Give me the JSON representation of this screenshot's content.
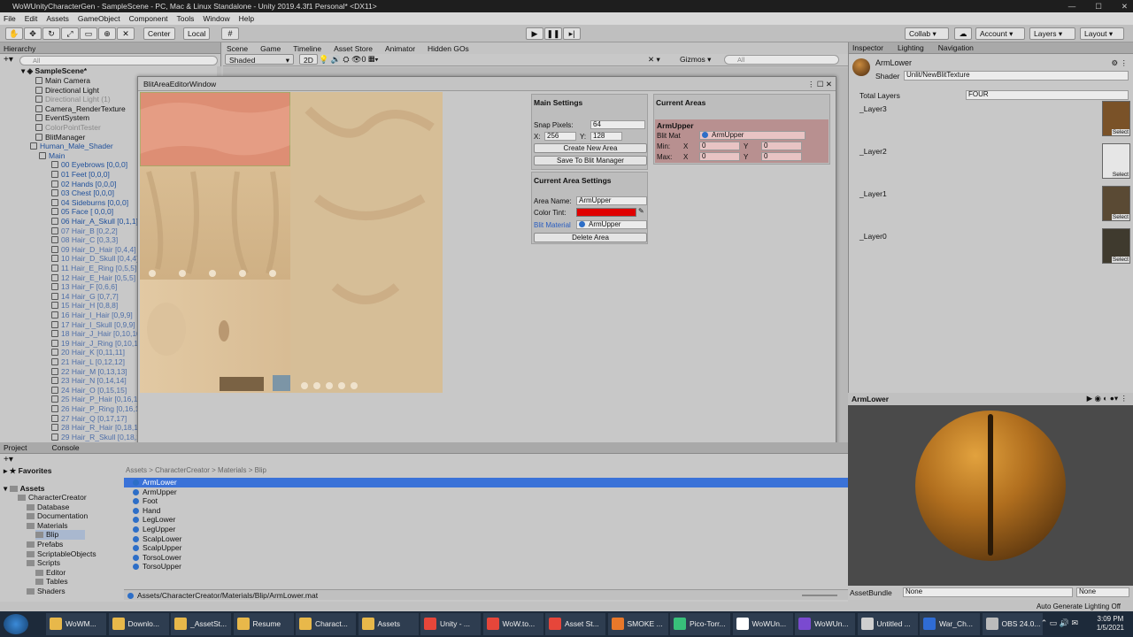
{
  "window": {
    "title": "WoWUnityCharacterGen - SampleScene - PC, Mac & Linux Standalone - Unity 2019.4.3f1 Personal* <DX11>"
  },
  "menu": [
    "File",
    "Edit",
    "Assets",
    "GameObject",
    "Component",
    "Tools",
    "Window",
    "Help"
  ],
  "toolbar": {
    "center": "Center",
    "local": "Local",
    "collab": "Collab",
    "account": "Account",
    "layers": "Layers",
    "layout": "Layout"
  },
  "hierarchy": {
    "tab": "Hierarchy",
    "search": "All",
    "scene": "SampleScene*",
    "items": [
      {
        "label": "Main Camera",
        "style": ""
      },
      {
        "label": "Directional Light",
        "style": ""
      },
      {
        "label": "Directional Light (1)",
        "style": "dim"
      },
      {
        "label": "Camera_RenderTexture",
        "style": ""
      },
      {
        "label": "EventSystem",
        "style": ""
      },
      {
        "label": "ColorPointTester",
        "style": "dim"
      },
      {
        "label": "BlitManager",
        "style": ""
      },
      {
        "label": "Human_Male_Shader",
        "style": "blue"
      },
      {
        "label": "Main",
        "style": "blue"
      },
      {
        "label": "00 Eyebrows [0,0,0]",
        "style": "blue"
      },
      {
        "label": "01 Feet [0,0,0]",
        "style": "blue"
      },
      {
        "label": "02 Hands [0,0,0]",
        "style": "blue"
      },
      {
        "label": "03 Chest [0,0,0]",
        "style": "blue"
      },
      {
        "label": "04 Sideburns [0,0,0]",
        "style": "blue"
      },
      {
        "label": "05 Face [ 0,0,0]",
        "style": "blue"
      },
      {
        "label": "06 Hair_A_Skull [0,1,1]",
        "style": "blue"
      },
      {
        "label": "07 Hair_B [0,2,2]",
        "style": "paleblue"
      },
      {
        "label": "08 Hair_C [0,3,3]",
        "style": "paleblue"
      },
      {
        "label": "09 Hair_D_Hair [0,4,4]",
        "style": "paleblue"
      },
      {
        "label": "10 Hair_D_Skull [0,4,4]",
        "style": "paleblue"
      },
      {
        "label": "11 Hair_E_Ring [0,5,5]",
        "style": "paleblue"
      },
      {
        "label": "12 Hair_E_Hair [0,5,5]",
        "style": "paleblue"
      },
      {
        "label": "13 Hair_F [0,6,6]",
        "style": "paleblue"
      },
      {
        "label": "14 Hair_G [0,7,7]",
        "style": "paleblue"
      },
      {
        "label": "15 Hair_H [0,8,8]",
        "style": "paleblue"
      },
      {
        "label": "16 Hair_I_Hair [0,9,9]",
        "style": "paleblue"
      },
      {
        "label": "17 Hair_I_Skull [0,9,9]",
        "style": "paleblue"
      },
      {
        "label": "18 Hair_J_Hair [0,10,10]",
        "style": "paleblue"
      },
      {
        "label": "19 Hair_J_Ring [0,10,10]",
        "style": "paleblue"
      },
      {
        "label": "20 Hair_K [0,11,11]",
        "style": "paleblue"
      },
      {
        "label": "21 Hair_L [0,12,12]",
        "style": "paleblue"
      },
      {
        "label": "22 Hair_M [0,13,13]",
        "style": "paleblue"
      },
      {
        "label": "23 Hair_N [0,14,14]",
        "style": "paleblue"
      },
      {
        "label": "24 Hair_O [0,15,15]",
        "style": "paleblue"
      },
      {
        "label": "25 Hair_P_Hair [0,16,16]",
        "style": "paleblue"
      },
      {
        "label": "26 Hair_P_Ring [0,16,16]",
        "style": "paleblue"
      },
      {
        "label": "27 Hair_Q [0,17,17]",
        "style": "paleblue"
      },
      {
        "label": "28 Hair_R_Hair [0,18,18]",
        "style": "paleblue"
      },
      {
        "label": "29 Hair_R_Skull [0,18,18]",
        "style": "paleblue"
      }
    ]
  },
  "scene_tabs": [
    "Scene",
    "Game",
    "Timeline",
    "Asset Store",
    "Animator",
    "Hidden GOs"
  ],
  "scene_bar": {
    "shaded": "Shaded",
    "mode2d": "2D",
    "gizmos": "Gizmos",
    "search": "All",
    "count": "0"
  },
  "blit_window": {
    "title": "BlitAreaEditorWindow",
    "main_settings": {
      "header": "Main Settings",
      "snap_label": "Snap Pixels:",
      "snap_value": "64",
      "x_label": "X:",
      "x_value": "256",
      "y_label": "Y:",
      "y_value": "128",
      "create_btn": "Create New Area",
      "save_btn": "Save To Blit Manager"
    },
    "area_settings": {
      "header": "Current Area Settings",
      "name_label": "Area Name:",
      "name_value": "ArmUpper",
      "tint_label": "Color Tint:",
      "tint_color": "#e00000",
      "material_label": "Blit Material",
      "material_value": "ArmUpper",
      "delete_btn": "Delete Area"
    },
    "current_areas": {
      "header": "Current Areas",
      "area_name": "ArmUpper",
      "blit_label": "Blit Mat",
      "blit_value": "ArmUpper",
      "min_label": "Min:",
      "max_label": "Max:",
      "x": "X",
      "y": "Y",
      "min_x": "0",
      "min_y": "0",
      "max_x": "0",
      "max_y": "0"
    }
  },
  "inspector": {
    "tabs": [
      "Inspector",
      "Lighting",
      "Navigation"
    ],
    "object": "ArmLower",
    "shader_label": "Shader",
    "shader_value": "Unlit/NewBlitTexture",
    "total_layers_label": "Total Layers",
    "total_layers_value": "FOUR",
    "layers": [
      {
        "label": "_Layer3",
        "color": "#7a5228"
      },
      {
        "label": "_Layer2",
        "color": "#e6e6e6"
      },
      {
        "label": "_Layer1",
        "color": "#5a4a34"
      },
      {
        "label": "_Layer0",
        "color": "#3f3a2e"
      }
    ],
    "select": "Select"
  },
  "preview": {
    "title": "ArmLower"
  },
  "asset_bundle": {
    "label": "AssetBundle",
    "value": "None",
    "variant": "None"
  },
  "project": {
    "tabs": [
      "Project",
      "Console"
    ],
    "favorites": "Favorites",
    "assets": "Assets",
    "tree": [
      {
        "label": "CharacterCreator",
        "indent": 1
      },
      {
        "label": "Database",
        "indent": 2
      },
      {
        "label": "Documentation",
        "indent": 2
      },
      {
        "label": "Materials",
        "indent": 2
      },
      {
        "label": "Blip",
        "indent": 3
      },
      {
        "label": "Prefabs",
        "indent": 2
      },
      {
        "label": "ScriptableObjects",
        "indent": 2
      },
      {
        "label": "Scripts",
        "indent": 2
      },
      {
        "label": "Editor",
        "indent": 3
      },
      {
        "label": "Tables",
        "indent": 3
      },
      {
        "label": "Shaders",
        "indent": 2
      }
    ],
    "breadcrumb": "Assets > CharacterCreator > Materials > Blip",
    "files": [
      "ArmLower",
      "ArmUpper",
      "Foot",
      "Hand",
      "LegLower",
      "LegUpper",
      "ScalpLower",
      "ScalpUpper",
      "TorsoLower",
      "TorsoUpper"
    ],
    "selected_path": "Assets/CharacterCreator/Materials/Blip/ArmLower.mat"
  },
  "status": "Auto Generate Lighting Off",
  "taskbar": {
    "items": [
      "WoWM...",
      "Downlo...",
      "_AssetSt...",
      "Resume",
      "Charact...",
      "Assets",
      "Unity - ...",
      "WoW.to...",
      "Asset St...",
      "SMOKE ...",
      "Pico-Torr...",
      "WoWUn...",
      "WoWUn...",
      "Untitled ...",
      "War_Ch...",
      "OBS 24.0..."
    ],
    "time": "3:09 PM",
    "date": "1/5/2021"
  },
  "colors": {
    "accent": "#3d7cd9",
    "selected": "#3a72d8",
    "area_bg": "#b89090"
  }
}
